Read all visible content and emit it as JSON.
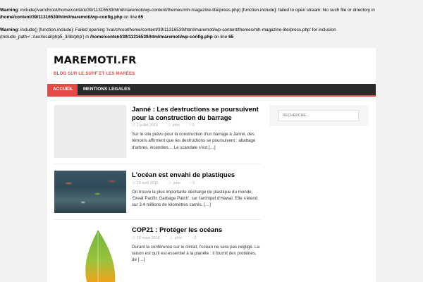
{
  "warnings": {
    "w1": {
      "label": "Warning",
      "text": ": include(/var/chroot/home/content/39/11316539/html/maremoti/wp-content/themes/mh-magazine-lite/press.php) [function.include]: failed to open stream: No such file or directory in",
      "path": "/home/content/39/11316539/html/maremoti/wp-config.php",
      "online": " on line ",
      "line": "65"
    },
    "w2": {
      "label": "Warning",
      "text": ": include() [function.include]: Failed opening '/var/chroot/home/content/39/11316539/html/maremoti/wp-content/themes/mh-magazine-lite/press.php' for inclusion (include_path='.:/usr/local/php5_3/lib/php') in ",
      "path": "/home/content/39/11316539/html/maremoti/wp-config.php",
      "online": " on line ",
      "line": "65"
    }
  },
  "site": {
    "title": "MAREMOTI.FR",
    "tagline": "BLOG SUR LE SURF ET LES MARÉES"
  },
  "nav": {
    "home": "ACCUEIL",
    "legal": "MENTIONS LEGALES"
  },
  "posts": [
    {
      "title": "Janné : Les destructions se poursuivent pour la construction du barrage",
      "date": "2 juillet 2016",
      "author": "john",
      "comments": "0",
      "excerpt": "Sur le site prévu pour la construction d'un barrage à Janné, des témoins affirment que les destructions se poursuivent : abattage d'arbres, incendies… Le scandale s'est",
      "more": "[…]"
    },
    {
      "title": "L'océan est envahi de plastiques",
      "date": "19 avril 2016",
      "author": "john",
      "comments": "0",
      "excerpt": "On trouve la plus importante décharge de plastique du monde, 'Great Pacific Garbage Patch', sur l'archipel d'Hawaï. Elle s'étend sur 3.4 millions de kilomètres carrés.",
      "more": "[…]"
    },
    {
      "title": "COP21 : Protéger les océans",
      "date": "16 mars 2016",
      "author": "john",
      "comments": "0",
      "excerpt": "Durant la conférence sur le climat, l'océan ne sera pas négligé. La raison est qu'il est essentiel à la planète : il fournit des protéines, de",
      "more": "[…]"
    }
  ],
  "sidebar": {
    "search_placeholder": "RECHERCHE..."
  },
  "icons": {
    "date": "clock-icon",
    "author": "user-icon",
    "comments": "comment-icon"
  },
  "colors": {
    "accent": "#e64946",
    "nav_bg": "#2a2a2a"
  }
}
